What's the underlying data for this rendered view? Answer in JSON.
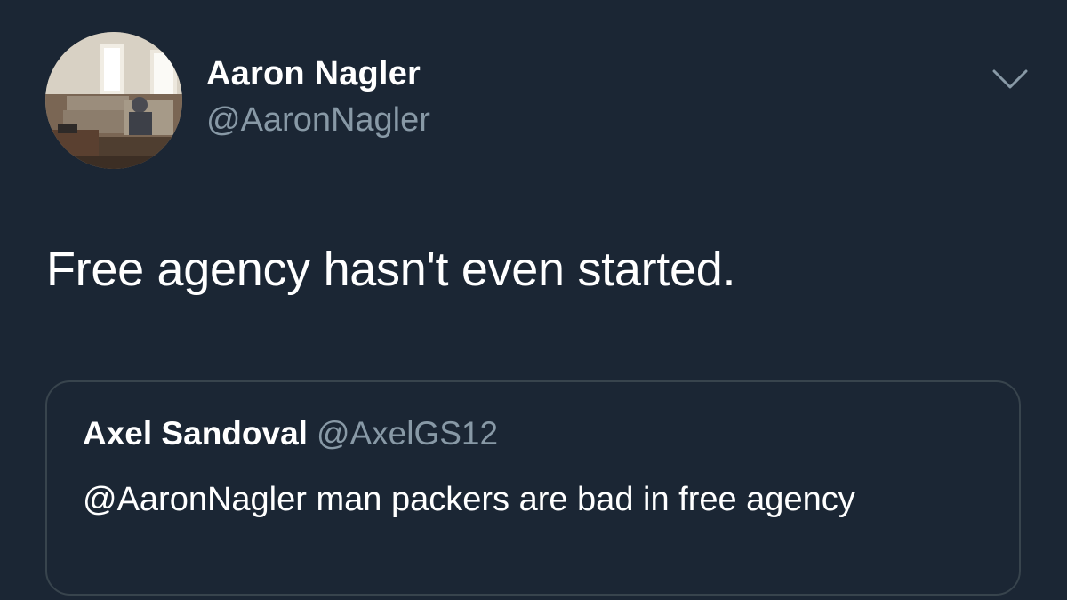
{
  "tweet": {
    "author": {
      "display_name": "Aaron Nagler",
      "handle": "@AaronNagler"
    },
    "text": "Free agency hasn't even started.",
    "menu_icon": "chevron-down-icon",
    "quoted": {
      "display_name": "Axel Sandoval",
      "handle": "@AxelGS12",
      "text": "@AaronNagler man packers are bad in free agency"
    }
  },
  "colors": {
    "background": "#1b2634",
    "primary_text": "#ffffff",
    "secondary_text": "#8899a6",
    "border": "#38444d"
  }
}
